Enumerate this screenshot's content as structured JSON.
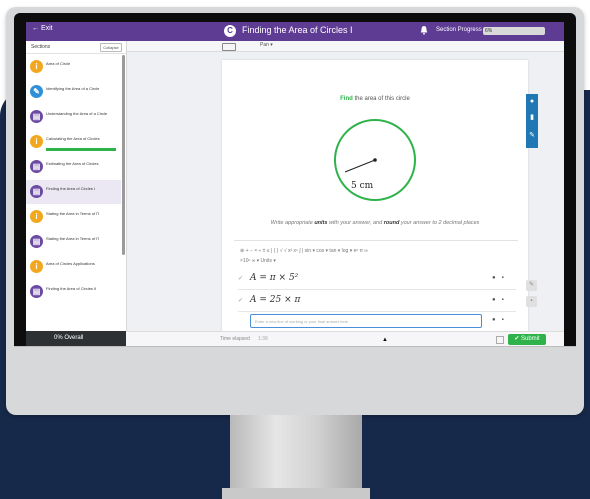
{
  "topbar": {
    "exit_label": "← Exit",
    "logo_letter": "C",
    "title": "Finding the Area of Circles I",
    "progress_label": "Section Progress",
    "progress_value": "6%"
  },
  "subbar": {
    "label": "Pan ▾"
  },
  "sidebar": {
    "title": "Sections",
    "button_label": "Collapse",
    "items": [
      {
        "label": "Area of Circle",
        "icon": "lightbulb-icon",
        "glyph": "i",
        "color": "#f2a81d"
      },
      {
        "label": "Identifying the Area of a Circle",
        "icon": "pencil-icon",
        "glyph": "✎",
        "color": "#2f8fd8"
      },
      {
        "label": "Understanding the Area of a Circle",
        "icon": "book-icon",
        "glyph": "▤",
        "color": "#6a4aa3"
      },
      {
        "label": "Calculating the Area of Circles",
        "icon": "lightbulb-icon",
        "glyph": "i",
        "color": "#f2a81d"
      },
      {
        "label": "Estimating the Area of Circles",
        "icon": "book-icon",
        "glyph": "▤",
        "color": "#6a4aa3"
      },
      {
        "label": "Finding the Area of Circles I",
        "icon": "book-icon",
        "glyph": "▤",
        "color": "#6a4aa3"
      },
      {
        "label": "Stating the Area in Terms of Π",
        "icon": "lightbulb-icon",
        "glyph": "i",
        "color": "#f2a81d"
      },
      {
        "label": "Stating the Area in Terms of Π",
        "icon": "book-icon",
        "glyph": "▤",
        "color": "#6a4aa3"
      },
      {
        "label": "Area of Circles Applications",
        "icon": "lightbulb-icon",
        "glyph": "i",
        "color": "#f2a81d"
      },
      {
        "label": "Finding the Area of Circles II",
        "icon": "book-icon",
        "glyph": "▤",
        "color": "#6a4aa3"
      }
    ],
    "footer": "0% Overall"
  },
  "question": {
    "find_word": "Find",
    "prompt": " the area of this circle",
    "radius_label": "5 cm",
    "write_pre": "Write appropriate ",
    "units_word": "units",
    "write_mid": " with your answer, and ",
    "round_word": "round",
    "write_post": " your answer to 2 decimal places"
  },
  "editor": {
    "toolbar_row1": "⊕  +  −  ×  ÷  ±  ≤  |  ( )   √   √  x²  xⁿ  ∫  |  sin ▾  cos ▾  tan ▾   log ▾   eˣ   π   ∞",
    "toolbar_row2": "×10ⁿ   ∞ ▾   Units ▾",
    "answers": [
      {
        "math": "A = π × 5²"
      },
      {
        "math": "A = 25 × π"
      }
    ],
    "input_placeholder": "Enter a new line of working or your final answer here"
  },
  "bottombar": {
    "time_label": "Time elapsed",
    "time_value": "1:38",
    "submit_label": "✔ Submit"
  },
  "colors": {
    "brand_purple": "#5f3c94",
    "accent_green": "#2db34a",
    "tool_blue": "#1f78b4",
    "circle_green": "#2db34a"
  }
}
